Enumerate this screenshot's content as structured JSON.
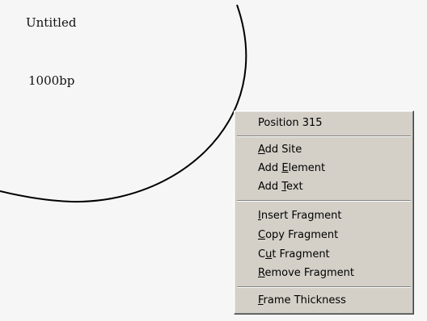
{
  "map": {
    "title": "Untitled",
    "length": "1000bp"
  },
  "context_menu": {
    "items": [
      {
        "label": "Position 315",
        "mnemonic_index": -1
      },
      {
        "label": "Add Site",
        "mnemonic_index": 0
      },
      {
        "label": "Add Element",
        "mnemonic_index": 4
      },
      {
        "label": "Add Text",
        "mnemonic_index": 4
      },
      {
        "label": "Insert Fragment",
        "mnemonic_index": 0
      },
      {
        "label": "Copy Fragment",
        "mnemonic_index": 0
      },
      {
        "label": "Cut Fragment",
        "mnemonic_index": 1
      },
      {
        "label": "Remove Fragment",
        "mnemonic_index": 0
      },
      {
        "label": "Frame Thickness",
        "mnemonic_index": 0
      }
    ]
  },
  "colors": {
    "canvas_background": "#f6f6f6",
    "menu_background": "#d4d0c8",
    "circle_stroke": "#000000"
  }
}
